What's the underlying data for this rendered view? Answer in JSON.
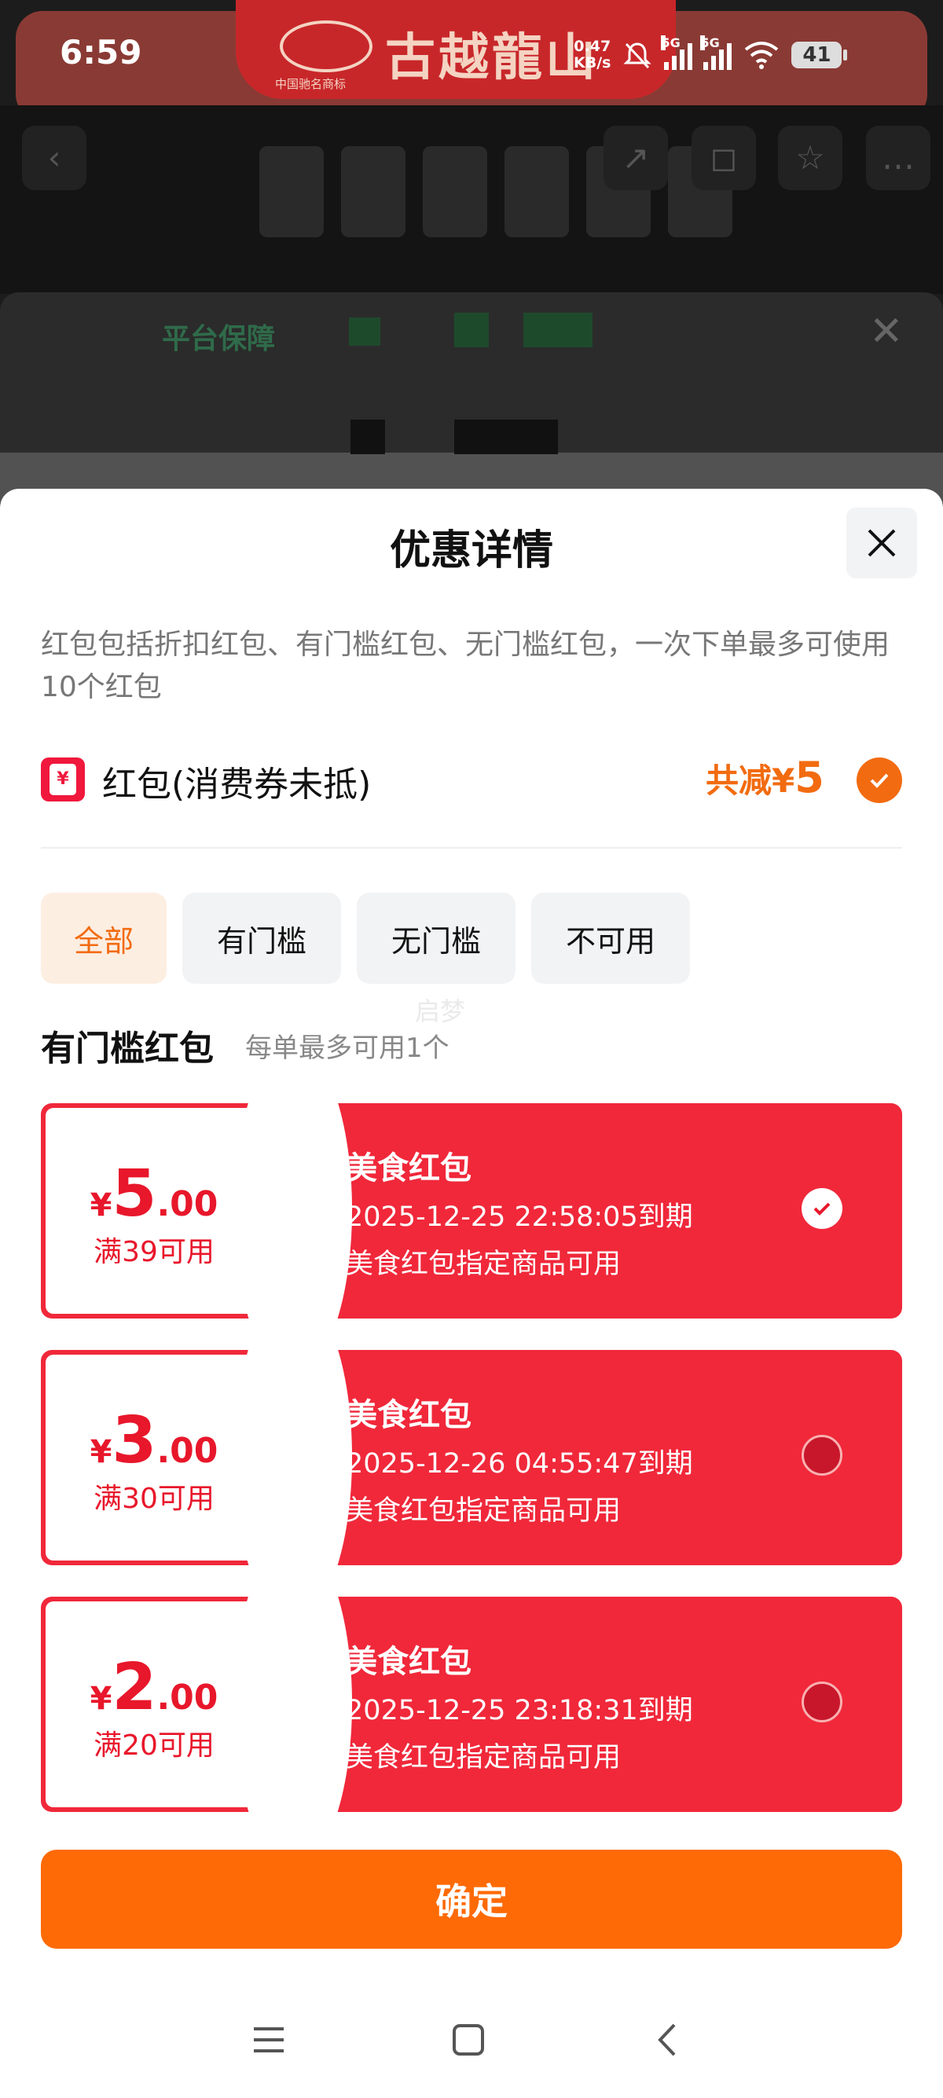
{
  "status_bar": {
    "time": "6:59",
    "net_speed_value": "0.47",
    "net_speed_unit": "KB/s",
    "sim1": "5G",
    "sim2": "5G",
    "battery": "41"
  },
  "background": {
    "brand_name": "古越龍山",
    "brand_top": "古越龙山",
    "brand_sub": "中国驰名商标",
    "sheet_title": "平台保障"
  },
  "sheet": {
    "title": "优惠详情",
    "description": "红包包括折扣红包、有门槛红包、无门槛红包，一次下单最多可使用10个红包",
    "redpacket_icon_glyph": "¥",
    "redpacket_label": "红包(消费券未抵)",
    "total_prefix": "共减",
    "total_currency": "¥",
    "total_amount": "5",
    "tabs": [
      {
        "label": "全部",
        "active": true
      },
      {
        "label": "有门槛",
        "active": false
      },
      {
        "label": "无门槛",
        "active": false
      },
      {
        "label": "不可用",
        "active": false
      }
    ],
    "watermark": "启梦",
    "section_title": "有门槛红包",
    "section_sub": "每单最多可用1个",
    "coupons": [
      {
        "currency": "¥",
        "amount_int": "5",
        "amount_dec": ".00",
        "condition": "满39可用",
        "name": "美食红包",
        "expiry": "2025-12-25 22:58:05到期",
        "scope": "美食红包指定商品可用",
        "selected": true
      },
      {
        "currency": "¥",
        "amount_int": "3",
        "amount_dec": ".00",
        "condition": "满30可用",
        "name": "美食红包",
        "expiry": "2025-12-26 04:55:47到期",
        "scope": "美食红包指定商品可用",
        "selected": false
      },
      {
        "currency": "¥",
        "amount_int": "2",
        "amount_dec": ".00",
        "condition": "满20可用",
        "name": "美食红包",
        "expiry": "2025-12-25 23:18:31到期",
        "scope": "美食红包指定商品可用",
        "selected": false
      }
    ],
    "confirm_label": "确定"
  },
  "colors": {
    "accent": "#fd6a06",
    "coupon_red": "#f0283a",
    "price_red": "#e8172b",
    "active_tab_bg": "#fdeee2"
  },
  "icons": {
    "close": "close-icon",
    "check": "check-icon",
    "redpacket": "red-packet-icon",
    "nav_menu": "menu-icon",
    "nav_home": "home-icon",
    "nav_back": "back-icon"
  }
}
